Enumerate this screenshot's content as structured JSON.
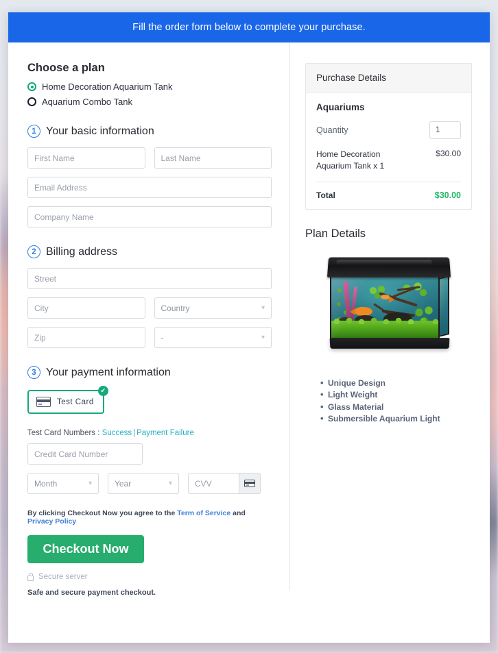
{
  "banner": {
    "text": "Fill the order form below to complete your purchase."
  },
  "plan": {
    "heading": "Choose a plan",
    "options": [
      {
        "label": "Home Decoration Aquarium Tank",
        "selected": true
      },
      {
        "label": "Aquarium Combo Tank",
        "selected": false
      }
    ]
  },
  "step1": {
    "number": "1",
    "title": "Your basic information",
    "first_name_placeholder": "First Name",
    "last_name_placeholder": "Last Name",
    "email_placeholder": "Email Address",
    "company_placeholder": "Company Name"
  },
  "step2": {
    "number": "2",
    "title": "Billing address",
    "street_placeholder": "Street",
    "city_placeholder": "City",
    "country_placeholder": "Country",
    "zip_placeholder": "Zip",
    "state_placeholder": "-"
  },
  "step3": {
    "number": "3",
    "title": "Your payment information",
    "card_tile_label": "Test  Card",
    "card_tile_check": "✔",
    "test_numbers_label": "Test Card Numbers : ",
    "test_numbers_success": "Success",
    "test_numbers_separator": "|",
    "test_numbers_failure": "Payment Failure",
    "card_number_placeholder": "Credit Card Number",
    "month_placeholder": "Month",
    "year_placeholder": "Year",
    "cvv_placeholder": "CVV"
  },
  "terms": {
    "prefix": "By clicking Checkout Now you agree to the ",
    "tos_link": "Term of Service",
    "conjunction": " and ",
    "privacy_link": "Privacy Policy"
  },
  "checkout": {
    "button_label": "Checkout Now",
    "secure_label": "Secure server",
    "safe_note": "Safe and secure payment checkout."
  },
  "purchase_details": {
    "header": "Purchase Details",
    "item_group": "Aquariums",
    "quantity_label": "Quantity",
    "quantity_value": "1",
    "line_item_name": "Home Decoration Aquarium Tank x 1",
    "line_item_price": "$30.00",
    "total_label": "Total",
    "total_value": "$30.00"
  },
  "plan_details": {
    "heading": "Plan Details",
    "image_alt": "aquarium-tank-photo",
    "features": [
      "Unique Design",
      "Light Weight",
      "Glass Material",
      "Submersible Aquarium Light"
    ]
  },
  "colors": {
    "banner_blue": "#1a66e8",
    "checkout_green": "#27ad6d",
    "total_green": "#1fb866",
    "selected_radio": "#12a87a",
    "step_circle_blue": "#2f7de1",
    "link_teal": "#24b0c4",
    "link_blue": "#3d7fd6"
  }
}
